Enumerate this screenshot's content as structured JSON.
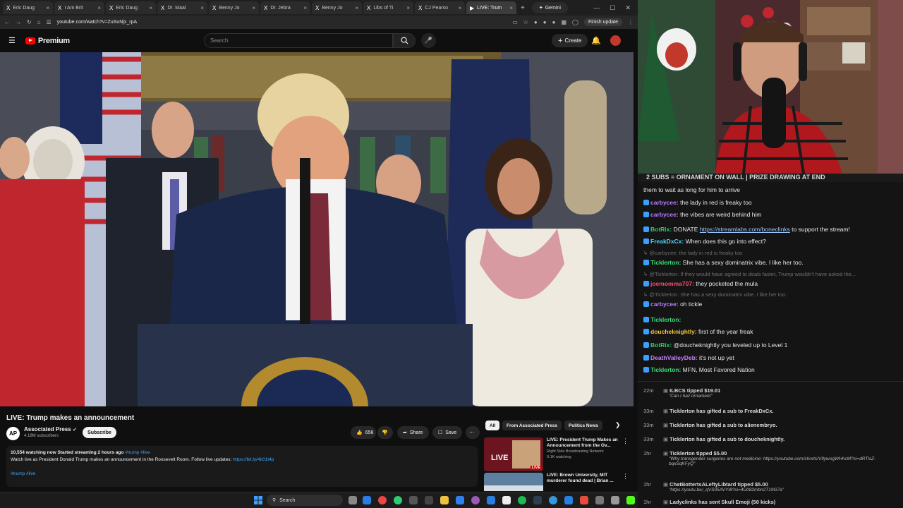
{
  "browser": {
    "tabs": [
      {
        "label": "Eric Daug",
        "active": false
      },
      {
        "label": "I Am Brit",
        "active": false
      },
      {
        "label": "Eric Daug",
        "active": false
      },
      {
        "label": "Dr. Maal",
        "active": false
      },
      {
        "label": "Benny Jo",
        "active": false
      },
      {
        "label": "Dr. Jebra",
        "active": false
      },
      {
        "label": "Benny Jo",
        "active": false
      },
      {
        "label": "Libs of Ti",
        "active": false
      },
      {
        "label": "CJ Pearso",
        "active": false
      },
      {
        "label": "LIVE: Trum",
        "active": true
      }
    ],
    "gemini_label": "Gemini",
    "url": "youtube.com/watch?v=ZuSuNjx_rpA",
    "update_label": "Finish update"
  },
  "youtube": {
    "logo_text": "Premium",
    "search_placeholder": "Search",
    "create_label": "Create",
    "video_title": "LIVE: Trump makes an announcement",
    "channel_name": "Associated Press",
    "channel_logo": "AP",
    "subscribers": "4.18M subscribers",
    "subscribe_label": "Subscribe",
    "likes": "656",
    "share_label": "Share",
    "save_label": "Save",
    "description": {
      "stats": "10,554 watching now  Started streaming 2 hours ago",
      "tags_inline": "#trump #live",
      "text": "Watch live as President Donald Trump makes an announcement in the Roosevelt Room. Follow live updates: ",
      "link": "https://bit.ly/4b01t4p",
      "tags": "#trump #live"
    },
    "chips": [
      "All",
      "From Associated Press",
      "Politics News"
    ],
    "related": [
      {
        "title": "LIVE: President Trump Makes an Announcement from the Ov...",
        "channel": "Right Side Broadcasting Network",
        "meta": "9.1K watching",
        "badge": "LIVE"
      },
      {
        "title": "LIVE: Brown University, MIT murderer found dead | Brian ...",
        "channel": "",
        "meta": "",
        "badge": ""
      }
    ]
  },
  "stream": {
    "banner": "2 SUBS = ORNAMENT ON WALL | PRIZE DRAWING AT END",
    "chat": [
      {
        "user": "",
        "text": "them to wait as long for him to arrive",
        "color": "#e8e8e8",
        "type": "msg"
      },
      {
        "user": "carbycee:",
        "text": "the lady in red is freaky too",
        "color": "#b57cff",
        "type": "msg"
      },
      {
        "user": "carbycee:",
        "text": "the vibes are weird behind him",
        "color": "#b57cff",
        "type": "msg"
      },
      {
        "user": "BotRix:",
        "text": "DONATE ",
        "link": "https://streamlabs.com/boneclinks",
        "after": " to support the stream!",
        "color": "#2ecc71",
        "type": "msg"
      },
      {
        "user": "FreakDxCx:",
        "text": "When does this go into effect?",
        "color": "#4fd1ff",
        "type": "msg"
      },
      {
        "user": "",
        "text": "@carbycee: the lady in red is freaky too",
        "color": "#6f6f6f",
        "type": "reply"
      },
      {
        "user": "Ticklerton:",
        "text": "She has a sexy dominatrix vibe. I like her too.",
        "color": "#3be07a",
        "type": "msg"
      },
      {
        "user": "",
        "text": "@Ticklerton: If they would have agreed to deals faster, Trump wouldn't have asked the...",
        "color": "#6f6f6f",
        "type": "reply"
      },
      {
        "user": "joemomma707:",
        "text": "they pocketed the mula",
        "color": "#ff4d6d",
        "type": "msg"
      },
      {
        "user": "",
        "text": "@Ticklerton: She has a sexy dominatrix vibe. I like her too.",
        "color": "#6f6f6f",
        "type": "reply"
      },
      {
        "user": "carbycee:",
        "text": "oh tickle",
        "color": "#b57cff",
        "type": "msg"
      },
      {
        "user": "Ticklerton:",
        "text": "",
        "color": "#3be07a",
        "type": "msg"
      },
      {
        "user": "doucheknightly:",
        "text": "first of the year freak",
        "color": "#f5c542",
        "type": "msg"
      },
      {
        "user": "BotRix:",
        "text": "@doucheknightly you leveled up to Level 1",
        "color": "#2ecc71",
        "type": "msg"
      },
      {
        "user": "DeathValleyDeb:",
        "text": "it's not up yet",
        "color": "#c77dff",
        "type": "msg"
      },
      {
        "user": "Ticklerton:",
        "text": "MFN, Most Favored Nation",
        "color": "#3be07a",
        "type": "msg"
      }
    ],
    "events": [
      {
        "time": "22m",
        "line": "ILBCS tipped $19.01",
        "quote": "\"Can I haz ornament\""
      },
      {
        "time": "33m",
        "line": "Ticklerton has gifted a sub to FreakDxCx.",
        "quote": ""
      },
      {
        "time": "33m",
        "line": "Ticklerton has gifted a sub to alienembryo.",
        "quote": ""
      },
      {
        "time": "33m",
        "line": "Ticklerton has gifted a sub to doucheknightly.",
        "quote": ""
      },
      {
        "time": "1hr",
        "line": "Ticklerton tipped $5.00",
        "quote": "\"Why transgender surgeries are not medicine: https://youtube.com/shorts/V9ywogWHhcM?si=dRTlsZ-bqxSqKFyQ\""
      },
      {
        "time": "1hr",
        "line": "ChatBottertsALeftyLibtard tipped $5.00",
        "quote": "\"https://youtu.be/_qVS05AVYI8?si=4U082mbn2T19G7a\""
      },
      {
        "time": "1hr",
        "line": "Ladyclinks has sent Skull Emoji (50 kicks)",
        "quote": ""
      }
    ]
  },
  "taskbar": {
    "search_label": "Search"
  },
  "colors": {
    "yt_red": "#ff0000",
    "link": "#3ea6ff",
    "kick_green": "#53fc18"
  }
}
